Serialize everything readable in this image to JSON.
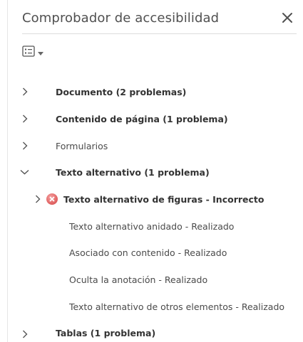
{
  "panel": {
    "title": "Comprobador de accesibilidad",
    "close_icon": "close-icon",
    "options_icon": "list-options-icon"
  },
  "tree": {
    "documento": "Documento (2 problemas)",
    "contenido": "Contenido de página (1 problema)",
    "formularios": "Formularios",
    "texto_alt": "Texto alternativo (1 problema)",
    "figuras": "Texto alternativo de figuras - Incorrecto",
    "anidado": "Texto alternativo anidado - Realizado",
    "asociado": "Asociado con contenido - Realizado",
    "oculta": "Oculta la anotación - Realizado",
    "otros": "Texto alternativo de otros elementos - Realizado",
    "tablas": "Tablas (1 problema)"
  },
  "colors": {
    "error_icon": "#e06666",
    "chevron": "#555555"
  }
}
